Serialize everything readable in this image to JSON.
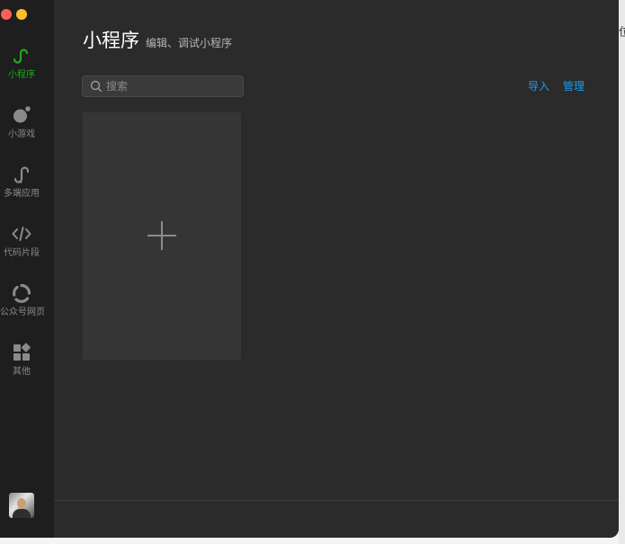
{
  "window_controls": {
    "close_color": "#fe5f57",
    "minimize_color": "#febc2e"
  },
  "sidebar": {
    "active_color": "#1aad19",
    "items": [
      {
        "label": "小程序",
        "icon": "miniprogram-icon",
        "active": true
      },
      {
        "label": "小游戏",
        "icon": "minigame-icon",
        "active": false
      },
      {
        "label": "多端应用",
        "icon": "multiplatform-icon",
        "active": false
      },
      {
        "label": "代码片段",
        "icon": "code-icon",
        "active": false
      },
      {
        "label": "公众号网页",
        "icon": "official-account-icon",
        "active": false
      },
      {
        "label": "其他",
        "icon": "grid-icon",
        "active": false
      }
    ],
    "avatar": "user-avatar"
  },
  "main": {
    "title": "小程序",
    "subtitle": "编辑、调试小程序",
    "search": {
      "placeholder": "搜索",
      "value": ""
    },
    "actions": {
      "import_label": "导入",
      "manage_label": "管理"
    },
    "link_color": "#1e9be8",
    "add_card_icon": "plus-icon"
  },
  "background": {
    "peek_text": "位"
  }
}
